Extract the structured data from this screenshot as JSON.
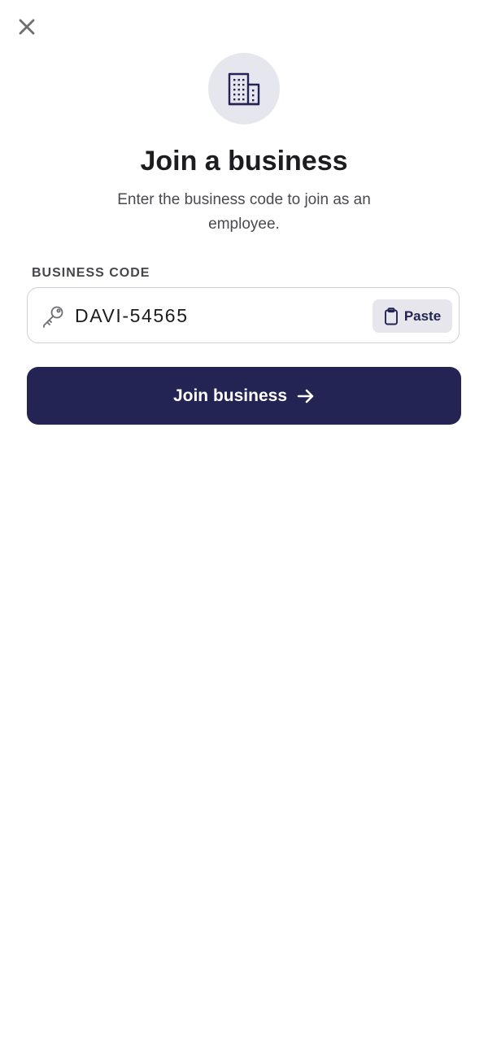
{
  "header": {
    "close_icon": "close-icon"
  },
  "hero": {
    "icon": "building-icon",
    "title": "Join a business",
    "subtitle": "Enter the business code to join as an employee."
  },
  "form": {
    "field_label": "BUSINESS CODE",
    "field_icon": "key-icon",
    "code_value": "DAVI-54565",
    "paste_icon": "clipboard-icon",
    "paste_label": "Paste"
  },
  "actions": {
    "join_label": "Join business",
    "join_icon": "arrow-right-icon"
  },
  "colors": {
    "primary": "#242454",
    "icon_bg": "#e6e6ee",
    "paste_bg": "#e6e6ec",
    "border": "#cfcfd4"
  }
}
